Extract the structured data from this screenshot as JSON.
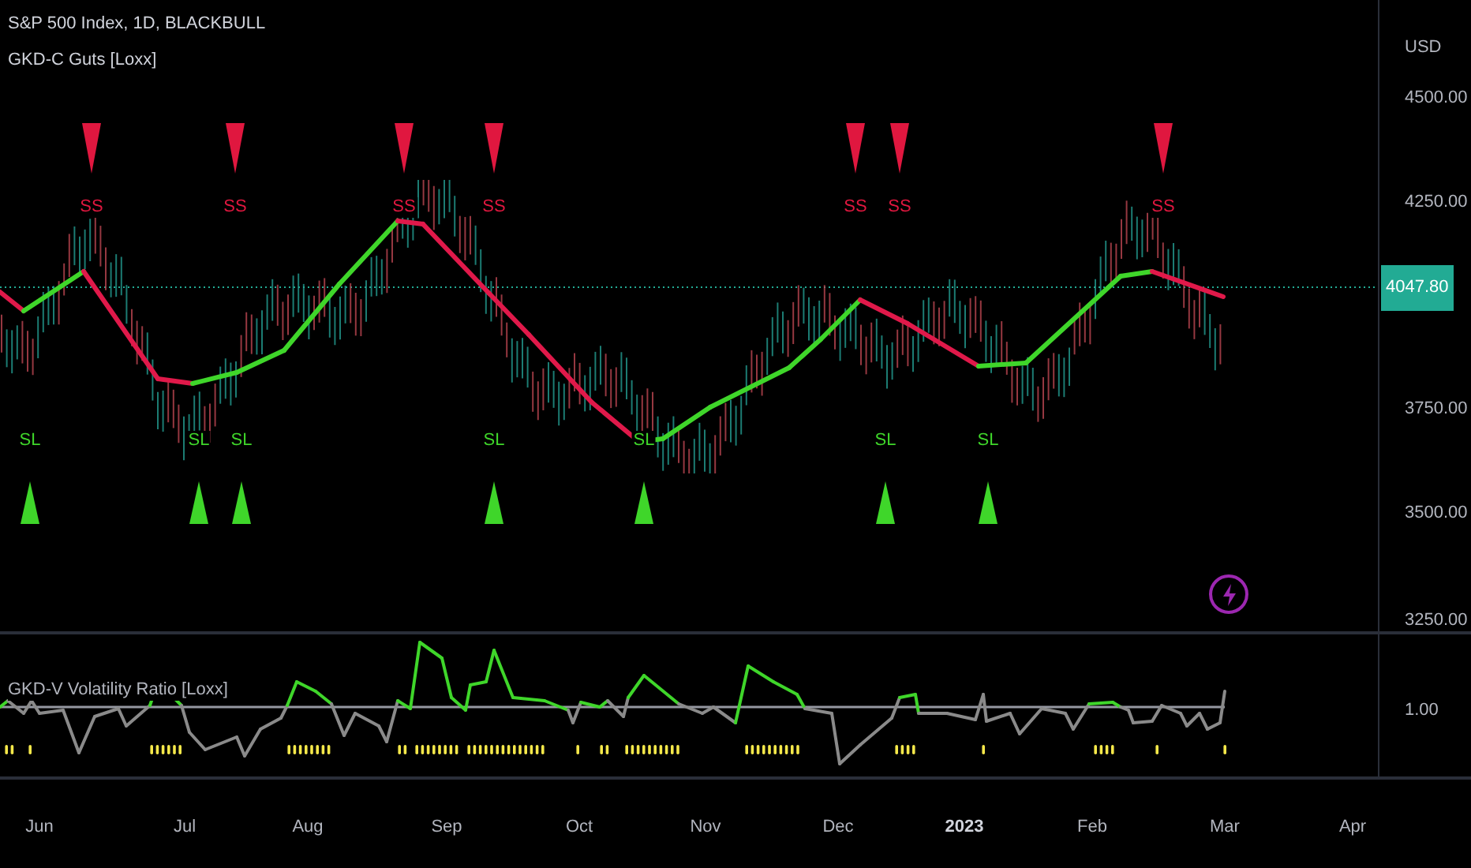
{
  "chart_header": {
    "symbol": "S&P 500 Index, 1D, BLACKBULL",
    "indicator": "GKD-C Guts [Loxx]"
  },
  "sell_signals": [
    {
      "label": "SS"
    },
    {
      "label": "SS"
    },
    {
      "label": "SS"
    },
    {
      "label": "SS"
    },
    {
      "label": "SS"
    },
    {
      "label": "SS"
    },
    {
      "label": "SS"
    }
  ],
  "buy_signals": [
    {
      "label": "SL"
    },
    {
      "label": "SL"
    },
    {
      "label": "SL"
    },
    {
      "label": "SL"
    },
    {
      "label": "SL"
    },
    {
      "label": "SL"
    },
    {
      "label": "SL"
    }
  ],
  "price_axis": {
    "currency": "USD",
    "ticks": [
      "4500.00",
      "4250.00",
      "3750.00",
      "3500.00",
      "3250.00"
    ],
    "last_price": "4047.80"
  },
  "oscillator": {
    "title": "GKD-V Volatility Ratio [Loxx]",
    "level_label": "1.00"
  },
  "time_axis": [
    {
      "label": "Jun",
      "kind": "month"
    },
    {
      "label": "Jul",
      "kind": "month"
    },
    {
      "label": "Aug",
      "kind": "month"
    },
    {
      "label": "Sep",
      "kind": "month"
    },
    {
      "label": "Oct",
      "kind": "month"
    },
    {
      "label": "Nov",
      "kind": "month"
    },
    {
      "label": "Dec",
      "kind": "month"
    },
    {
      "label": "2023",
      "kind": "year"
    },
    {
      "label": "Feb",
      "kind": "month"
    },
    {
      "label": "Mar",
      "kind": "month"
    },
    {
      "label": "Apr",
      "kind": "month"
    }
  ]
}
